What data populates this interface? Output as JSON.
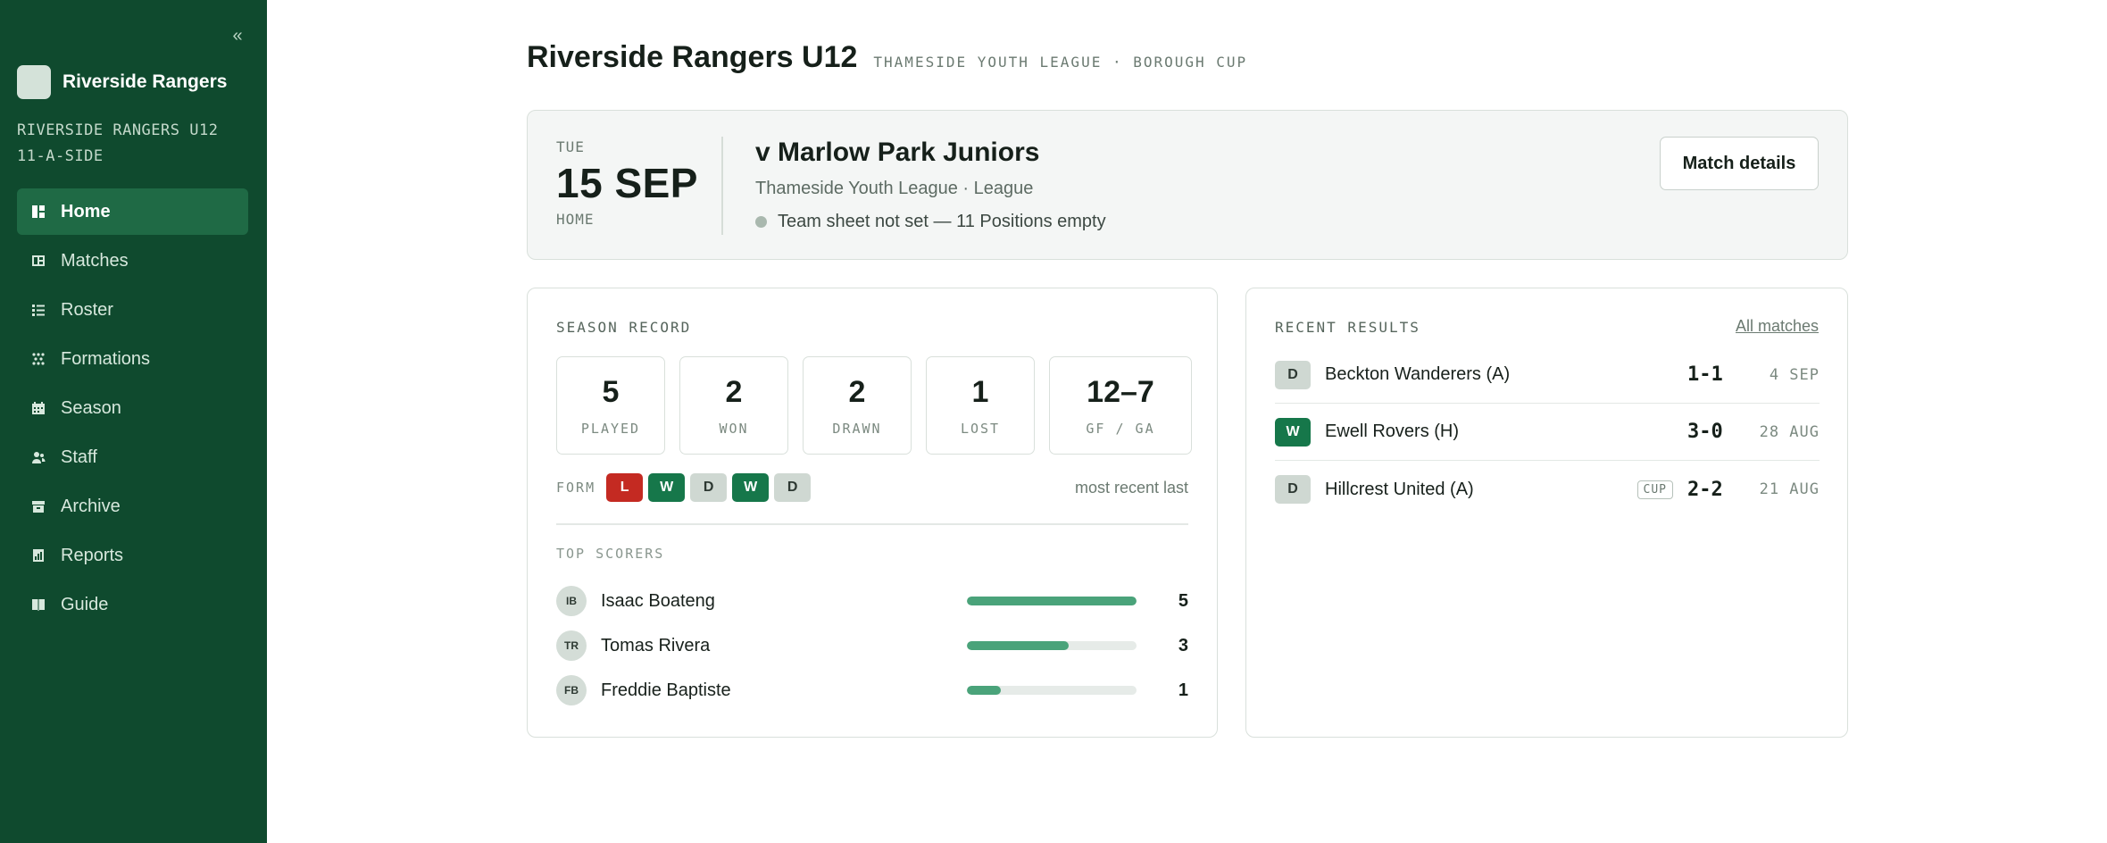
{
  "sidebar": {
    "collapse_label": "«",
    "brand_name": "Riverside Rangers",
    "team_line1": "RIVERSIDE RANGERS U12",
    "team_line2": "11-A-SIDE",
    "items": [
      {
        "label": "Home",
        "icon": "dashboard-icon",
        "active": true
      },
      {
        "label": "Matches",
        "icon": "matches-icon",
        "active": false
      },
      {
        "label": "Roster",
        "icon": "list-icon",
        "active": false
      },
      {
        "label": "Formations",
        "icon": "formation-icon",
        "active": false
      },
      {
        "label": "Season",
        "icon": "calendar-icon",
        "active": false
      },
      {
        "label": "Staff",
        "icon": "staff-icon",
        "active": false
      },
      {
        "label": "Archive",
        "icon": "archive-icon",
        "active": false
      },
      {
        "label": "Reports",
        "icon": "reports-icon",
        "active": false
      },
      {
        "label": "Guide",
        "icon": "guide-icon",
        "active": false
      }
    ]
  },
  "header": {
    "title": "Riverside Rangers U12",
    "subtitle": "THAMESIDE YOUTH LEAGUE · BOROUGH CUP"
  },
  "next_match": {
    "day": "TUE",
    "date": "15 SEP",
    "venue": "HOME",
    "opponent": "v Marlow Park Juniors",
    "competition": "Thameside Youth League · League",
    "status": "Team sheet not set — 11 Positions empty",
    "details_button": "Match details"
  },
  "season": {
    "section_label": "SEASON RECORD",
    "stats": [
      {
        "value": "5",
        "label": "PLAYED"
      },
      {
        "value": "2",
        "label": "WON"
      },
      {
        "value": "2",
        "label": "DRAWN"
      },
      {
        "value": "1",
        "label": "LOST"
      },
      {
        "value": "12–7",
        "label": "GF / GA"
      }
    ],
    "form_label": "FORM",
    "form": [
      "L",
      "W",
      "D",
      "W",
      "D"
    ],
    "form_note": "most recent last",
    "scorers_label": "TOP SCORERS",
    "scorers_max": 5,
    "scorers": [
      {
        "initials": "IB",
        "name": "Isaac Boateng",
        "goals": "5"
      },
      {
        "initials": "TR",
        "name": "Tomas Rivera",
        "goals": "3"
      },
      {
        "initials": "FB",
        "name": "Freddie Baptiste",
        "goals": "1"
      }
    ]
  },
  "results": {
    "section_label": "RECENT RESULTS",
    "all_link": "All matches",
    "items": [
      {
        "result": "D",
        "opponent": "Beckton Wanderers (A)",
        "cup": "",
        "score": "1-1",
        "date": "4 SEP"
      },
      {
        "result": "W",
        "opponent": "Ewell Rovers (H)",
        "cup": "",
        "score": "3-0",
        "date": "28 AUG"
      },
      {
        "result": "D",
        "opponent": "Hillcrest United (A)",
        "cup": "CUP",
        "score": "2-2",
        "date": "21 AUG"
      }
    ]
  },
  "colors": {
    "sidebar": "#0f4a2e",
    "accent": "#1f6a45",
    "win": "#16774a",
    "loss": "#c42a22",
    "draw": "#cfd8d2",
    "bar": "#4aa37a"
  }
}
